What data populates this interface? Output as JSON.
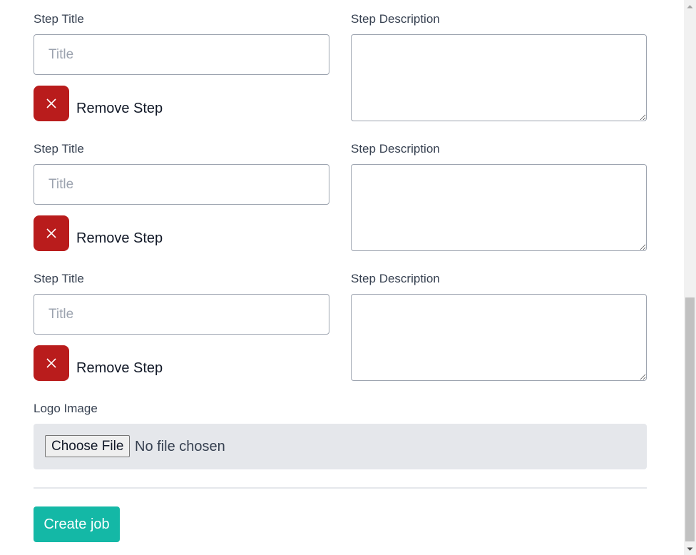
{
  "steps": [
    {
      "title_label": "Step Title",
      "title_placeholder": "Title",
      "description_label": "Step Description",
      "remove_label": "Remove Step"
    },
    {
      "title_label": "Step Title",
      "title_placeholder": "Title",
      "description_label": "Step Description",
      "remove_label": "Remove Step"
    },
    {
      "title_label": "Step Title",
      "title_placeholder": "Title",
      "description_label": "Step Description",
      "remove_label": "Remove Step"
    }
  ],
  "logo": {
    "label": "Logo Image",
    "choose_button": "Choose File",
    "status": "No file chosen"
  },
  "actions": {
    "create_label": "Create job"
  },
  "colors": {
    "remove_button": "#b91c1c",
    "create_button": "#14b8a6",
    "file_box_bg": "#e5e7eb"
  },
  "icons": {
    "remove": "close-icon"
  }
}
